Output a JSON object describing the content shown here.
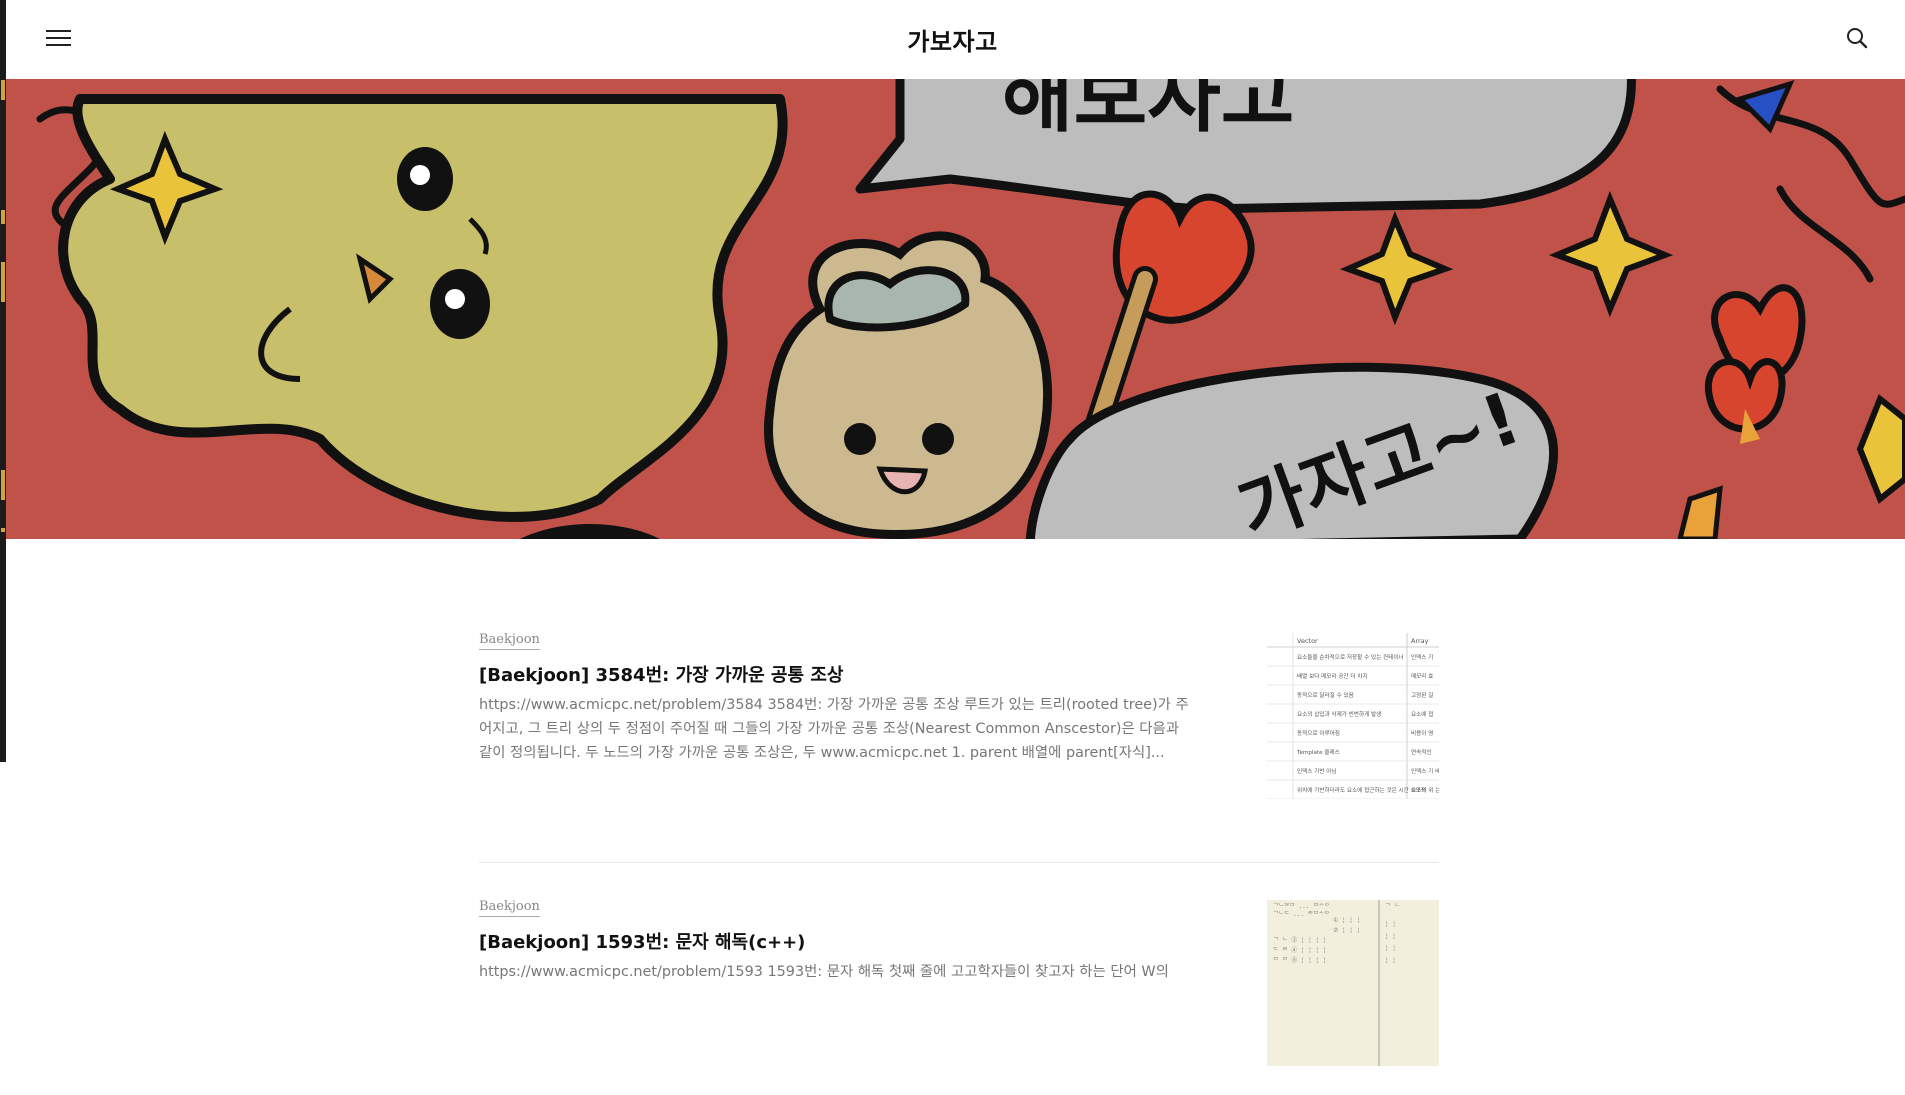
{
  "header": {
    "site_title": "가보자고"
  },
  "hero": {
    "speech_top": "해보자고",
    "speech_bottom": "가자고~!"
  },
  "posts": [
    {
      "category": "Baekjoon",
      "title": "[Baekjoon] 3584번: 가장 가까운 공통 조상",
      "excerpt": "https://www.acmicpc.net/problem/3584 3584번: 가장 가까운 공통 조상 루트가 있는 트리(rooted tree)가 주어지고, 그 트리 상의 두 정점이 주어질 때 그들의 가장 가까운 공통 조상(Nearest Common Anscestor)은 다음과 같이 정의됩니다. 두 노드의 가장 가까운 공통 조상은, 두 www.acmicpc.net 1. parent 배열에 parent[자식]...",
      "thumbnail": {
        "headers": [
          "Vector",
          "Array"
        ],
        "rows": [
          [
            "요소들을 순차적으로 저장할 수 있는 컨테이너",
            "인덱스 기"
          ],
          [
            "배열 보다 메모리 공간 더 차지",
            "메모리 효"
          ],
          [
            "동적으로 달라질 수 있음",
            "고정된 길"
          ],
          [
            "요소의 삽입과 삭제가 빈번하게 발생",
            "요소에 접"
          ],
          [
            "동적으로 이루어짐",
            "비용이 영"
          ],
          [
            "Template 클래스",
            "연속적인"
          ],
          [
            "인덱스 기반 아님",
            "인덱스 기 배열 지원 막 원소를"
          ],
          [
            "위치에 기반하더라도 요소에 접근하는 것은 시간 소모적",
            "요소의 위 는 시간은"
          ]
        ]
      }
    },
    {
      "category": "Baekjoon",
      "title": "[Baekjoon] 1593번: 문자 해독(c++)",
      "excerpt": "https://www.acmicpc.net/problem/1593 1593번: 문자 해독 첫째 줄에 고고학자들이 찾고자 하는 단어 W의"
    }
  ],
  "colors": {
    "hero_bg": "#c0524a",
    "yellow_creature": "#c8bf6b",
    "bear": "#cdb98f",
    "speech_bubble": "#bdbdbd",
    "flame": "#d8452e",
    "sparkle": "#e9c43a"
  },
  "icons": [
    "hamburger-menu-icon",
    "search-icon"
  ]
}
